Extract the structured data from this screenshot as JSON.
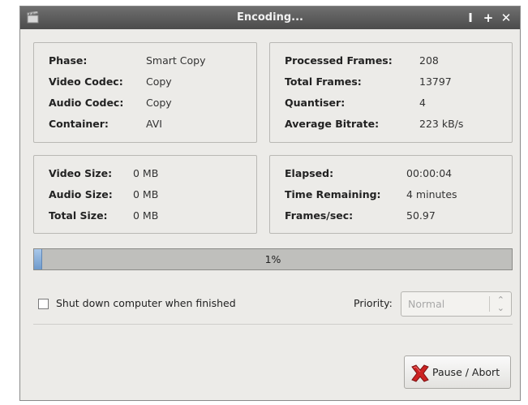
{
  "window": {
    "title": "Encoding...",
    "buttons": {
      "minimize": "I",
      "maximize": "+",
      "close": "✕"
    }
  },
  "info": {
    "phase_label": "Phase:",
    "phase_value": "Smart Copy",
    "video_codec_label": "Video Codec:",
    "video_codec_value": "Copy",
    "audio_codec_label": "Audio Codec:",
    "audio_codec_value": "Copy",
    "container_label": "Container:",
    "container_value": "AVI"
  },
  "stats": {
    "processed_label": "Processed Frames:",
    "processed_value": "208",
    "total_label": "Total Frames:",
    "total_value": "13797",
    "quantiser_label": "Quantiser:",
    "quantiser_value": "4",
    "bitrate_label": "Average Bitrate:",
    "bitrate_value": "223 kB/s"
  },
  "sizes": {
    "video_label": "Video Size:",
    "video_value": "0 MB",
    "audio_label": "Audio Size:",
    "audio_value": "0 MB",
    "total_label": "Total Size:",
    "total_value": "0 MB"
  },
  "timing": {
    "elapsed_label": "Elapsed:",
    "elapsed_value": "00:00:04",
    "remaining_label": "Time Remaining:",
    "remaining_value": "4 minutes",
    "fps_label": "Frames/sec:",
    "fps_value": "50.97"
  },
  "progress": {
    "text": "1%",
    "fraction": 0.015
  },
  "shutdown": {
    "label": "Shut down computer when finished",
    "checked": false
  },
  "priority": {
    "label": "Priority:",
    "value": "Normal",
    "disabled": true
  },
  "action": {
    "label": "Pause / Abort",
    "icon": "red-x-icon"
  },
  "colors": {
    "titlebar": "#555555",
    "window_bg": "#ecebe8",
    "progress_fill": "#7aa4d4",
    "abort_icon": "#cc2222"
  }
}
